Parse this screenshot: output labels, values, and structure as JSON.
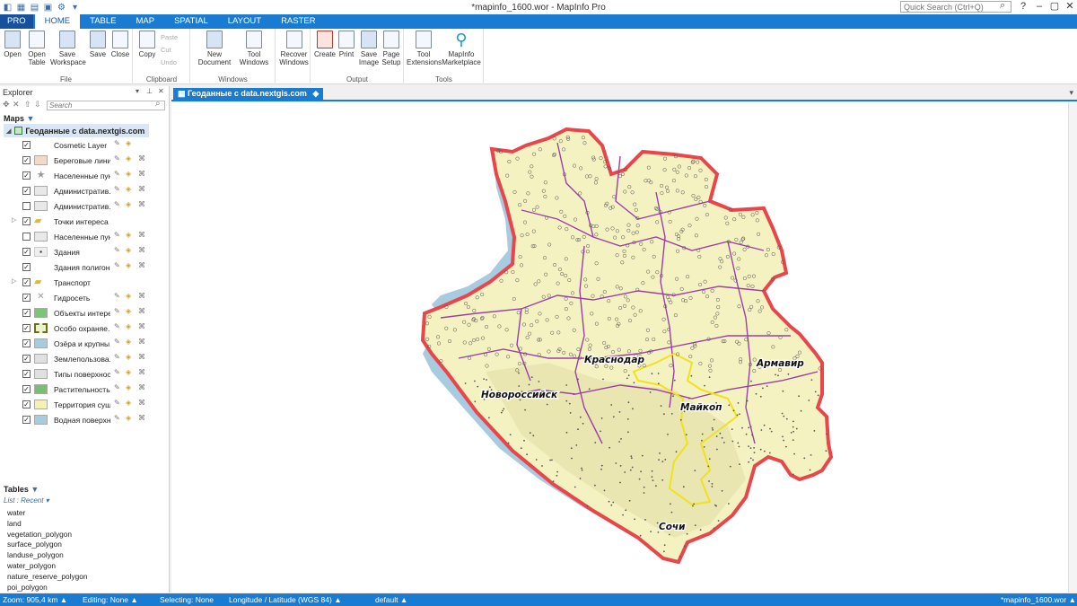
{
  "window": {
    "title": "*mapinfo_1600.wor - MapInfo Pro",
    "quick_search_placeholder": "Quick Search (Ctrl+Q)"
  },
  "ribbon": {
    "tabs": [
      "PRO",
      "HOME",
      "TABLE",
      "MAP",
      "SPATIAL",
      "LAYOUT",
      "RASTER"
    ],
    "active_tab": "HOME",
    "groups": {
      "file": {
        "label": "File",
        "open": "Open",
        "open_table": "Open Table",
        "save_workspace": "Save Workspace",
        "save": "Save",
        "close": "Close"
      },
      "clipboard": {
        "label": "Clipboard",
        "copy": "Copy",
        "paste": "Paste",
        "cut": "Cut",
        "undo": "Undo"
      },
      "windows": {
        "label": "Windows",
        "new_document": "New Document",
        "tool_windows": "Tool Windows"
      },
      "recover": {
        "recover_windows": "Recover Windows"
      },
      "output": {
        "label": "Output",
        "create": "Create",
        "print": "Print",
        "save_image": "Save Image",
        "page_setup": "Page Setup"
      },
      "tools": {
        "label": "Tools",
        "tool_extensions": "Tool Extensions",
        "mapinfo_marketplace": "MapInfo Marketplace"
      }
    }
  },
  "explorer": {
    "title": "Explorer",
    "search_placeholder": "Search",
    "maps_label": "Maps",
    "map_name": "Геоданные с data.nextgis.com",
    "layers": [
      {
        "name": "Cosmetic Layer",
        "checked": true,
        "swatch": "none"
      },
      {
        "name": "Береговые линии",
        "checked": true,
        "swatch": "#f3d9c8"
      },
      {
        "name": "Населенные пун...",
        "checked": true,
        "swatch": "star"
      },
      {
        "name": "Административ...",
        "checked": true,
        "swatch": "#e8e8e8"
      },
      {
        "name": "Административ...",
        "checked": false,
        "swatch": "#e8e8e8"
      },
      {
        "name": "Точки интереса",
        "checked": true,
        "swatch": "folder"
      },
      {
        "name": "Населенные пун...",
        "checked": false,
        "swatch": "#e8e8e8"
      },
      {
        "name": "Здания",
        "checked": true,
        "swatch": "dot"
      },
      {
        "name": "Здания полигоны",
        "checked": true,
        "swatch": "none"
      },
      {
        "name": "Транспорт",
        "checked": true,
        "swatch": "folder"
      },
      {
        "name": "Гидросеть",
        "checked": true,
        "swatch": "cross"
      },
      {
        "name": "Объекты интере...",
        "checked": true,
        "swatch": "#7dc47a"
      },
      {
        "name": "Особо охраняе...",
        "checked": true,
        "swatch": "dashed"
      },
      {
        "name": "Озёра и крупны...",
        "checked": true,
        "swatch": "#a9cbe0"
      },
      {
        "name": "Землепользова...",
        "checked": true,
        "swatch": "#e0e0e0"
      },
      {
        "name": "Типы поверхнос...",
        "checked": true,
        "swatch": "#e0e0e0"
      },
      {
        "name": "Растительность",
        "checked": true,
        "swatch": "#79bf6f"
      },
      {
        "name": "Территория суши",
        "checked": true,
        "swatch": "#f3f0b8"
      },
      {
        "name": "Водная поверхн...",
        "checked": true,
        "swatch": "#a9cbe0"
      }
    ],
    "tables_label": "Tables",
    "tables_sub": "List : Recent",
    "tables": [
      "water",
      "land",
      "vegetation_polygon",
      "surface_polygon",
      "landuse_polygon",
      "water_polygon",
      "nature_reserve_polygon",
      "poi_polygon"
    ]
  },
  "map_window": {
    "tab_title": "Геоданные с data.nextgis.com",
    "labels": {
      "krasnodar": "Краснодар",
      "armavir": "Армавир",
      "novorossiysk": "Новороссийск",
      "maykop": "Майкоп",
      "sochi": "Сочи"
    },
    "colors": {
      "land": "#f5f2c2",
      "sea": "#a9cbe0",
      "border": "#e8464b",
      "districts": "#9b3fa8",
      "adygea": "#f0e21a"
    }
  },
  "statusbar": {
    "zoom": "Zoom: 905,4 km",
    "editing": "Editing: None",
    "selecting": "Selecting: None",
    "projection": "Longitude / Latitude (WGS 84)",
    "style": "default",
    "workspace": "*mapinfo_1600.wor"
  }
}
